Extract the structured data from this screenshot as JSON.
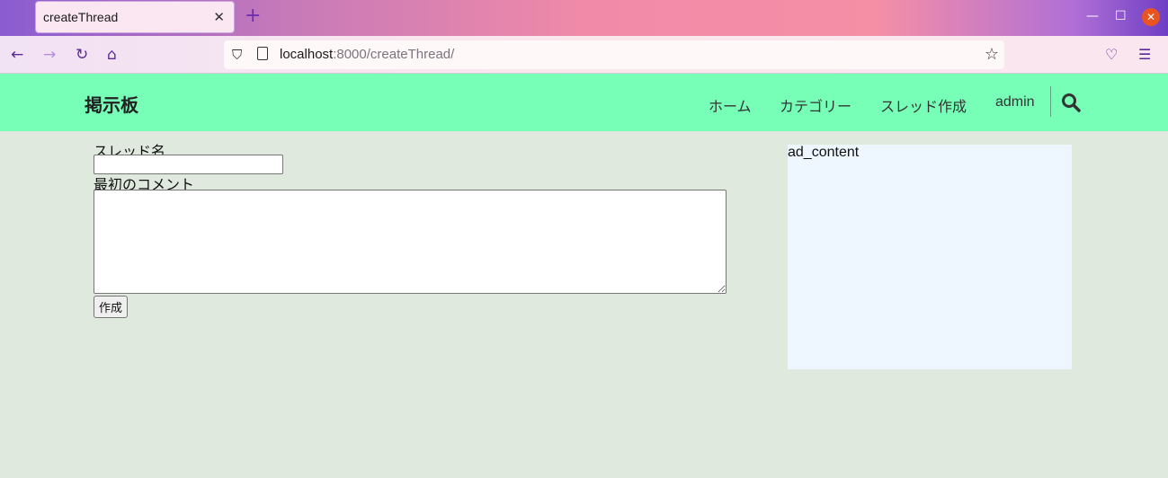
{
  "browser": {
    "tab_title": "createThread",
    "tab_close": "✕",
    "new_tab": "+",
    "url_host": "localhost",
    "url_rest": ":8000/createThread/"
  },
  "header": {
    "brand": "掲示板",
    "nav": [
      "ホーム",
      "カテゴリー",
      "スレッド作成",
      "admin"
    ]
  },
  "form": {
    "thread_name_label": "スレッド名",
    "thread_name_value": "",
    "first_comment_label": "最初のコメント",
    "first_comment_value": "",
    "submit_label": "作成"
  },
  "ad": {
    "content": "ad_content"
  },
  "colors": {
    "header_bg": "#77ffb8",
    "page_bg": "#e0e9de",
    "ad_bg": "#eef6ff"
  }
}
